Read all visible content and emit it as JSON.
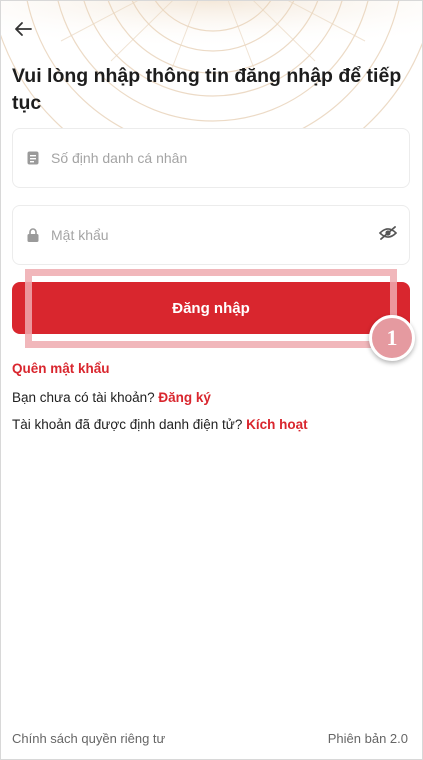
{
  "header": {
    "back_icon": "arrow-left-icon",
    "title": "Vui lòng nhập thông tin đăng nhập để tiếp tục"
  },
  "form": {
    "id_field": {
      "placeholder": "Số định danh cá nhân",
      "value": "",
      "icon": "id-card-icon"
    },
    "password_field": {
      "placeholder": "Mật khẩu",
      "value": "",
      "icon": "lock-icon",
      "toggle_icon": "eye-off-icon"
    },
    "login_label": "Đăng nhập"
  },
  "annotation": {
    "step_number": "1"
  },
  "links": {
    "forgot_password": "Quên mật khẩu",
    "no_account_text": "Bạn chưa có tài khoản?",
    "register": "Đăng ký",
    "activated_text": "Tài khoản đã được định danh điện tử?",
    "activate": "Kích hoạt"
  },
  "footer": {
    "privacy": "Chính sách quyền riêng tư",
    "version": "Phiên bản 2.0"
  },
  "colors": {
    "primary": "#d9262e",
    "highlight": "#eeaaaf",
    "badge": "#e59aa0"
  }
}
